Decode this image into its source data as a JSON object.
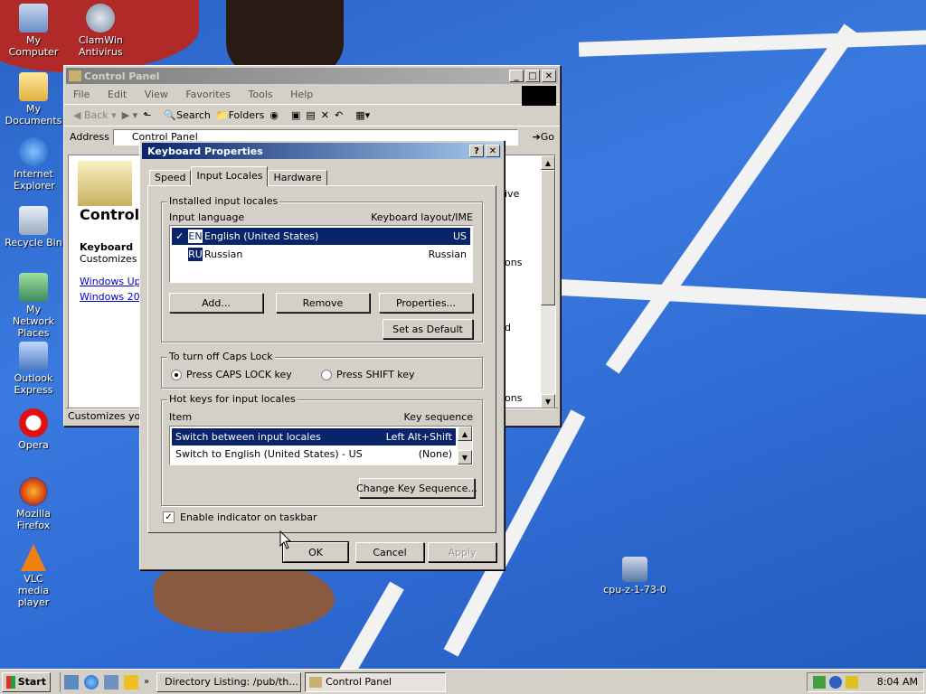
{
  "desktop": {
    "icons": [
      {
        "label": "My Computer"
      },
      {
        "label": "My Documents"
      },
      {
        "label": "Internet Explorer"
      },
      {
        "label": "Recycle Bin"
      },
      {
        "label": "My Network Places"
      },
      {
        "label": "Outlook Express"
      },
      {
        "label": "Opera"
      },
      {
        "label": "Mozilla Firefox"
      },
      {
        "label": "VLC media player"
      },
      {
        "label": "ClamWin Antivirus"
      },
      {
        "label": "cpu-z-1-73-0"
      }
    ]
  },
  "control_panel": {
    "title": "Control Panel",
    "menu": [
      "File",
      "Edit",
      "View",
      "Favorites",
      "Tools",
      "Help"
    ],
    "toolbar": {
      "back": "Back",
      "search": "Search",
      "folders": "Folders"
    },
    "address_label": "Address",
    "address_value": "Control Panel",
    "go_label": "Go",
    "left_pane": {
      "heading": "Control",
      "item_title": "Keyboard",
      "item_desc": "Customizes yo",
      "links": [
        "Windows Upd",
        "Windows 2000"
      ]
    },
    "right_fragments": [
      "ive",
      "ons",
      "d",
      "ons"
    ],
    "status_text": "Customizes your"
  },
  "dialog": {
    "title": "Keyboard Properties",
    "tabs": [
      "Speed",
      "Input Locales",
      "Hardware"
    ],
    "installed_group": "Installed input locales",
    "col_language": "Input language",
    "col_layout": "Keyboard layout/IME",
    "locales": [
      {
        "code": "EN",
        "name": "English (United States)",
        "layout": "US",
        "checked": "✓"
      },
      {
        "code": "RU",
        "name": "Russian",
        "layout": "Russian",
        "checked": ""
      }
    ],
    "add_label": "Add...",
    "remove_label": "Remove",
    "properties_label": "Properties...",
    "set_default_label": "Set as Default",
    "caps_group": "To turn off Caps Lock",
    "caps_option_1": "Press CAPS LOCK key",
    "caps_option_2": "Press SHIFT key",
    "hotkeys_group": "Hot keys for input locales",
    "col_item": "Item",
    "col_keyseq": "Key sequence",
    "hotkeys": [
      {
        "item": "Switch between input locales",
        "seq": "Left Alt+Shift"
      },
      {
        "item": "Switch to English (United States) - US",
        "seq": "(None)"
      }
    ],
    "change_key_label": "Change Key Sequence...",
    "indicator_label": "Enable indicator on taskbar",
    "ok_label": "OK",
    "cancel_label": "Cancel",
    "apply_label": "Apply"
  },
  "taskbar": {
    "start_label": "Start",
    "tasks": [
      "Directory Listing: /pub/th...",
      "Control Panel"
    ],
    "clock": "8:04 AM"
  },
  "colors": {
    "title_active": "#0a246a",
    "selection": "#0a246a",
    "face": "#d4d0c8"
  }
}
